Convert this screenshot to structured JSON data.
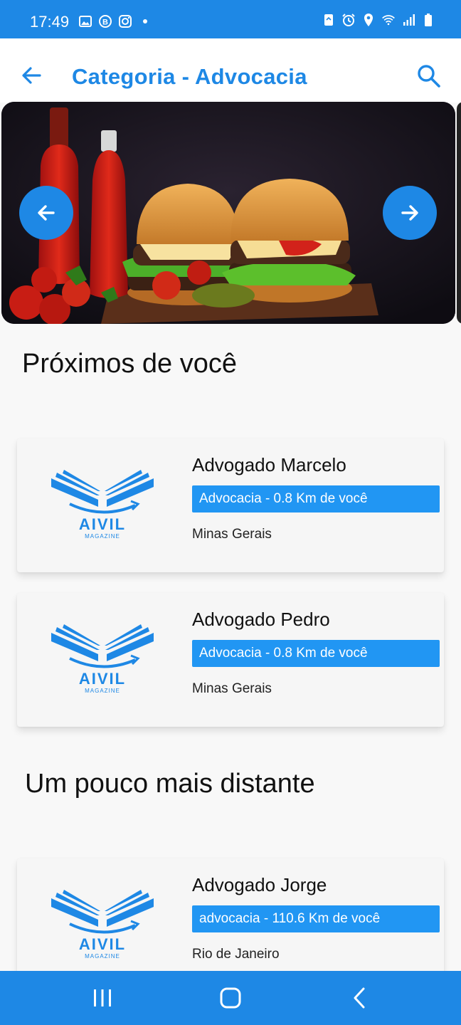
{
  "status_bar": {
    "time": "17:49"
  },
  "app_bar": {
    "title": "Categoria - Advocacia"
  },
  "colors": {
    "primary": "#1e88e5",
    "tag": "#2196f3"
  },
  "carousel": {
    "image": "burger-banner",
    "prev_icon": "arrow-left-icon",
    "next_icon": "arrow-right-icon"
  },
  "sections": {
    "near": {
      "title": "Próximos de você"
    },
    "far": {
      "title": "Um pouco mais distante"
    }
  },
  "listings": [
    {
      "name": "Advogado Marcelo",
      "tag": "Advocacia - 0.8 Km de você",
      "place": "Minas Gerais"
    },
    {
      "name": "Advogado Pedro",
      "tag": "Advocacia - 0.8 Km de você",
      "place": "Minas Gerais"
    },
    {
      "name": "Advogado Jorge",
      "tag": "advocacia - 110.6 Km de você",
      "place": "Rio de Janeiro"
    }
  ],
  "logo": {
    "brand": "AIVIL",
    "sub": "MAGAZINE"
  },
  "nav_bar": {
    "items": [
      "recents-icon",
      "home-icon",
      "back-icon"
    ]
  }
}
